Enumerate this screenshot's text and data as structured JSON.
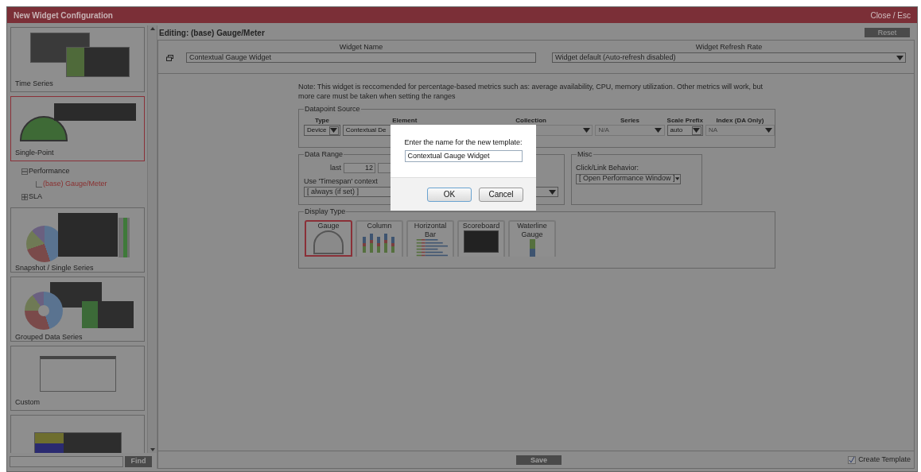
{
  "window": {
    "title": "New Widget Configuration",
    "close_label": "Close / Esc"
  },
  "sidebar": {
    "cards": [
      {
        "label": "Time Series",
        "kind": "table",
        "selected": false
      },
      {
        "label": "Single-Point",
        "kind": "gauge",
        "selected": true
      },
      {
        "label": "Snapshot / Single Series",
        "kind": "pie",
        "selected": false
      },
      {
        "label": "Grouped Data Series",
        "kind": "donut",
        "selected": false
      },
      {
        "label": "Custom",
        "kind": "browser",
        "selected": false
      },
      {
        "kind": "grid",
        "selected": false
      }
    ],
    "tree": [
      {
        "label": "Performance",
        "expanded": true,
        "children": [
          {
            "label": "(base) Gauge/Meter",
            "selected": true
          }
        ]
      },
      {
        "label": "SLA",
        "expanded": false
      }
    ],
    "find_button": "Find"
  },
  "editor": {
    "heading": "Editing: (base) Gauge/Meter",
    "reset_button": "Reset",
    "widget_name_label": "Widget Name",
    "widget_name": "Contextual Gauge Widget",
    "refresh_label": "Widget Refresh Rate",
    "refresh_value": "Widget default (Auto-refresh disabled)",
    "note": "Note: This widget is reccomended for percentage-based metrics such as: average availability, CPU, memory utilization. Other metrics will work, but more care must be taken when setting the ranges",
    "datapoint_source": {
      "legend": "Datapoint Source",
      "fields": [
        {
          "label": "Type",
          "value": "Device",
          "disabled": false
        },
        {
          "label": "Element",
          "value": "Contextual De",
          "disabled": false
        },
        {
          "label": "Collection",
          "disabled": true
        },
        {
          "label": "Series",
          "value": "N/A",
          "disabled": true
        },
        {
          "label": "Scale Prefix",
          "value": "auto",
          "disabled": false
        },
        {
          "label": "Index (DA Only)",
          "value": "NA",
          "disabled": true
        }
      ]
    },
    "data_range": {
      "legend": "Data Range",
      "last_label": "last",
      "last_value": "12",
      "timespan_label": "Use 'Timespan' context",
      "timespan_value": "[ always (if set) ]"
    },
    "misc": {
      "legend": "Misc",
      "link_label": "Click/Link Behavior:",
      "link_value": "[ Open Performance Window ]"
    },
    "display_type": {
      "legend": "Display Type",
      "options": [
        {
          "label": "Gauge",
          "kind": "gauge",
          "selected": true
        },
        {
          "label": "Column",
          "kind": "column",
          "selected": false
        },
        {
          "label": "Horizontal Bar",
          "kind": "hbar",
          "selected": false
        },
        {
          "label": "Scoreboard",
          "kind": "scoreboard",
          "selected": false
        },
        {
          "label": "Waterline Gauge",
          "kind": "waterline",
          "selected": false
        }
      ]
    },
    "save_button": "Save",
    "create_template": {
      "label": "Create Template",
      "checked": true
    }
  },
  "dialog": {
    "prompt": "Enter the name for the new template:",
    "value": "Contextual Gauge Widget",
    "buttons": [
      "OK",
      "Cancel"
    ]
  }
}
